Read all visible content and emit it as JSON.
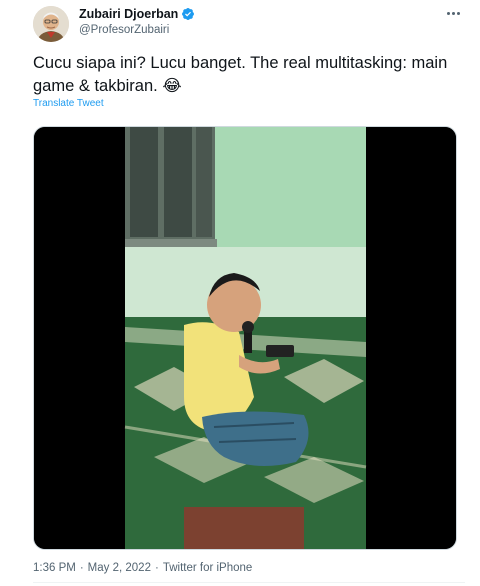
{
  "author": {
    "name": "Zubairi Djoerban",
    "handle": "@ProfesorZubairi"
  },
  "tweet": {
    "text": "Cucu siapa ini? Lucu banget. The real multitasking: main game & takbiran. 😂",
    "translate_label": "Translate Tweet"
  },
  "meta": {
    "time": "1:36 PM",
    "separator": "·",
    "date": "May 2, 2022",
    "source": "Twitter for iPhone"
  },
  "colors": {
    "accent": "#1d9bf0",
    "text": "#0f1419",
    "secondary": "#536471"
  },
  "icons": {
    "verified": "verified-badge-icon",
    "more": "more-options-icon"
  }
}
